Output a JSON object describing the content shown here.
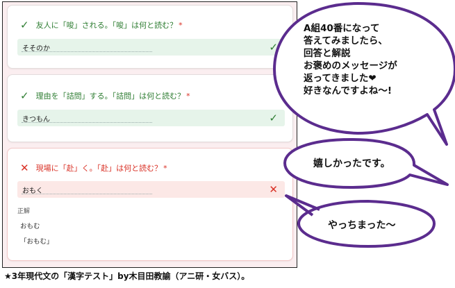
{
  "questions": [
    {
      "status": "correct",
      "prompt": "友人に「唆」される。「唆」は何と読む？",
      "required": "*",
      "answer": "そそのか",
      "status_icon": "check-icon"
    },
    {
      "status": "correct",
      "prompt": "理由を「詰問」する。「詰問」は何と読む？",
      "required": "*",
      "answer": "きつもん",
      "status_icon": "check-icon"
    },
    {
      "status": "incorrect",
      "prompt": "現場に「赴」く。「赴」は何と読む？",
      "required": "*",
      "answer": "おもく",
      "status_icon": "cross-icon",
      "correct_label": "正解",
      "correct_answers": [
        "おもむ",
        "「おもむ」"
      ]
    }
  ],
  "bubbles": {
    "big": [
      "A組40番になって",
      "答えてみましたら、",
      "回答と解説",
      "お褒めのメッセージが",
      "返ってきました❤",
      "好きなんですよね～!"
    ],
    "middle": "嬉しかったです。",
    "bottom": "やっちまった～"
  },
  "caption": "★3年現代文の「漢字テスト」by木目田教諭（アニ研・女バス）。",
  "colors": {
    "correct": "#2e7d32",
    "incorrect": "#d93025",
    "bubble_outline": "#5b2c8e"
  }
}
